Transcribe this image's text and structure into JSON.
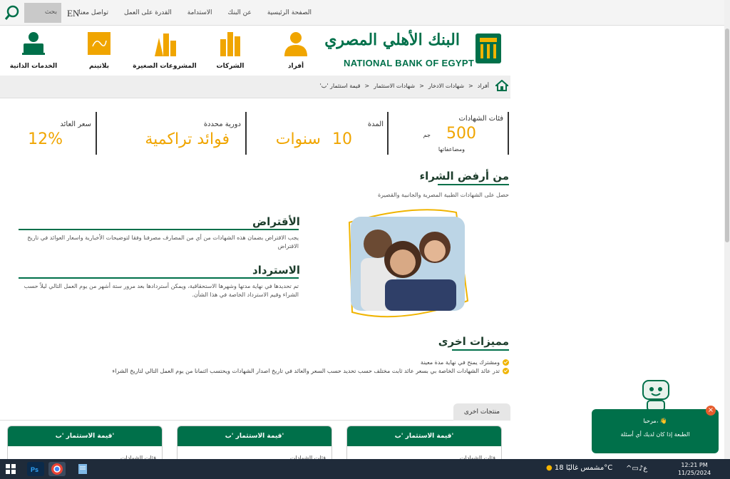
{
  "topbar": {
    "search_label": "بحث",
    "lang": "EN",
    "nav": [
      "الصفحة الرئيسية",
      "عن البنك",
      "الاستدامة",
      "القدرة على العمل",
      "تواصل معنا"
    ]
  },
  "logo": {
    "arabic": "البنك الأهلي المصري",
    "english": "NATIONAL BANK OF EGYPT"
  },
  "categories": [
    {
      "label": "أفراد",
      "icon": "person-icon"
    },
    {
      "label": "الشركات",
      "icon": "buildings-icon"
    },
    {
      "label": "المشروعات الصغيرة",
      "icon": "small-business-icon"
    },
    {
      "label": "بلاتينم",
      "icon": "platinum-icon"
    },
    {
      "label": "الخدمات الذاتية",
      "icon": "self-service-icon"
    }
  ],
  "breadcrumb": [
    "أفراد",
    "شهادات الادخار",
    "شهادات الاستثمار",
    "قيمة استثمار 'ب'"
  ],
  "stats": {
    "cert_label": "فئات الشهادات",
    "cert_value": "500",
    "cert_unit": "جم",
    "cert_multiples": "ومضاعفاتها",
    "duration_label": "المدة",
    "duration_value": "10",
    "duration_unit": "سنوات",
    "periodicity_label": "دورية محددة",
    "periodicity_value": "فوائد تراكمية",
    "yield_label": "سعر العائد",
    "yield_value": "12%"
  },
  "purchase": {
    "title": "من أرفض الشراء",
    "text": "حصل على الشهادات الطبية المصرية والجانبية والقصيرة"
  },
  "loan": {
    "title": "الأقتراض",
    "text": "يجب الاقتراض بضمان هذه الشهادات من أي من المصارف مصرفنا وفقا لتوضيحات الأخبارية واسعار العوائد في تاريخ الاقتراض"
  },
  "redemption": {
    "title": "الاسترداد",
    "text": "تم تحديدها في نهاية مدتها وشهرها الاستحقاقية، ويمكن أستردادها بعد مرور ستة أشهر من يوم العمل التالي ليلاً حسب الشراء وقيم الاسترداد الخاصة في هذا الشأن."
  },
  "features": {
    "title": "مميزات اخرى",
    "items": [
      "ومشترك يمنح في نهاية مدة معينة",
      "تدر عائد الشهادات الخاصة بي بسعر عائد ثابت مختلف حسب تحديد حسب السعر والعائد في تاريخ اصدار الشهادات ويحتسب ائتمانا من يوم العمل التالي لتاريخ الشراء"
    ]
  },
  "other_products": {
    "tab": "منتجات اخرى",
    "cards": [
      {
        "title": "قيمة الاستثمار 'ب'",
        "sub": "فئات الشهادات"
      },
      {
        "title": "قيمة الاستثمار 'ب'",
        "sub": "فئات الشهادات"
      },
      {
        "title": "قيمة الاستثمار 'ب'",
        "sub": "فئات الشهادات"
      }
    ]
  },
  "chat": {
    "greeting": "مرحبا، 👋",
    "prompt": "الطبعة إذا كان لديك أي أسئلة"
  },
  "taskbar": {
    "weather": "مشمس غالبًا 18°C",
    "lang": "ع",
    "time": "12:21 PM",
    "date": "11/25/2024"
  },
  "colors": {
    "brand_green": "#00704a",
    "accent_gold": "#f0a500"
  }
}
